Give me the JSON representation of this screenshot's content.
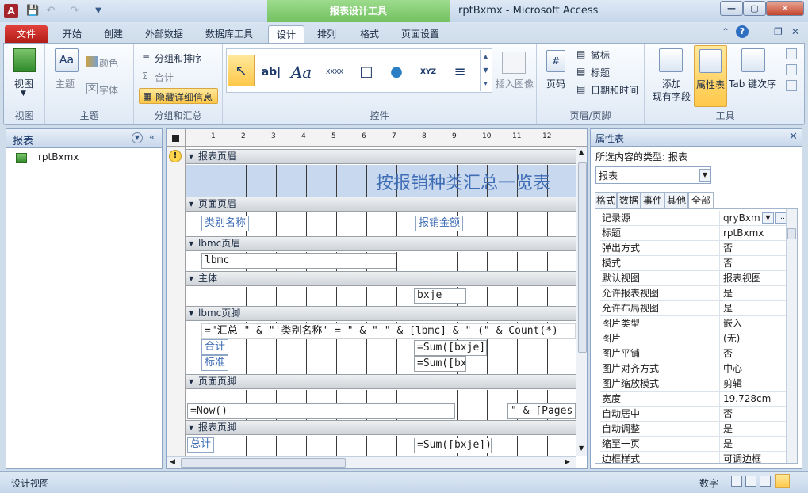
{
  "window": {
    "title": "rptBxmx  -  Microsoft Access",
    "context_tab_title": "报表设计工具",
    "app_icon_letter": "A"
  },
  "tabs": [
    "文件",
    "开始",
    "创建",
    "外部数据",
    "数据库工具",
    "设计",
    "排列",
    "格式",
    "页面设置"
  ],
  "ribbon": {
    "view": {
      "label": "视图",
      "group": "视图"
    },
    "theme": {
      "theme_label": "主题",
      "color_label": "颜色",
      "font_label": "字体",
      "group": "主题"
    },
    "grouping": {
      "sort_label": "分组和排序",
      "total_label": "合计",
      "hide_details_label": "隐藏详细信息",
      "group": "分组和汇总"
    },
    "controls": {
      "group": "控件",
      "label_glyph": "ab|",
      "aa_glyph": "Aa",
      "xxxx_glyph": "XXXX",
      "xyz_glyph": "XYZ"
    },
    "insert_image": {
      "label": "插入图像"
    },
    "header_footer": {
      "page_number_label": "页码",
      "logo_label": "徽标",
      "title_label": "标题",
      "datetime_label": "日期和时间",
      "group": "页眉/页脚"
    },
    "tools": {
      "add_fields_line1": "添加",
      "add_fields_line2": "现有字段",
      "property_sheet_label": "属性表",
      "tab_order_label": "Tab 键次序",
      "group": "工具"
    }
  },
  "nav": {
    "header": "报表",
    "items": [
      {
        "label": "rptBxmx"
      }
    ]
  },
  "design": {
    "ruler_labels": [
      "1",
      "2",
      "3",
      "4",
      "5",
      "6",
      "7",
      "8",
      "9",
      "10",
      "11",
      "12"
    ],
    "sections": {
      "report_header": "报表页眉",
      "page_header": "页面页眉",
      "lbmc_header": "lbmc页眉",
      "detail": "主体",
      "lbmc_footer": "lbmc页脚",
      "page_footer": "页面页脚",
      "report_footer": "报表页脚"
    },
    "title_text": "按报销种类汇总一览表",
    "page_header_labels": [
      "类别名称",
      "报销金额"
    ],
    "lbmc_field": "lbmc",
    "detail_field": "bxje",
    "footer_expr": "=\"汇总 \" & \"'类别名称' = \" & \" \" & [lbmc] & \" (\" & Count(*)",
    "subtotal_label": "合计",
    "subtotal_expr": "=Sum([bxje]",
    "std_label": "标准",
    "std_expr": "=Sum([bx",
    "now_expr": "=Now()",
    "pages_expr": "\" & [Pages",
    "grand_label": "总计",
    "grand_expr": "=Sum([bxje])"
  },
  "property_sheet": {
    "title": "属性表",
    "selection_type": "所选内容的类型: 报表",
    "object_select": "报表",
    "tabs": [
      "格式",
      "数据",
      "事件",
      "其他",
      "全部"
    ],
    "active_tab": "全部",
    "rows": [
      {
        "key": "记录源",
        "value": "qryBxmx"
      },
      {
        "key": "标题",
        "value": "rptBxmx"
      },
      {
        "key": "弹出方式",
        "value": "否"
      },
      {
        "key": "模式",
        "value": "否"
      },
      {
        "key": "默认视图",
        "value": "报表视图"
      },
      {
        "key": "允许报表视图",
        "value": "是"
      },
      {
        "key": "允许布局视图",
        "value": "是"
      },
      {
        "key": "图片类型",
        "value": "嵌入"
      },
      {
        "key": "图片",
        "value": "(无)"
      },
      {
        "key": "图片平铺",
        "value": "否"
      },
      {
        "key": "图片对齐方式",
        "value": "中心"
      },
      {
        "key": "图片缩放模式",
        "value": "剪辑"
      },
      {
        "key": "宽度",
        "value": "19.728cm"
      },
      {
        "key": "自动居中",
        "value": "否"
      },
      {
        "key": "自动调整",
        "value": "是"
      },
      {
        "key": "缩至一页",
        "value": "是"
      },
      {
        "key": "边框样式",
        "value": "可调边框"
      }
    ]
  },
  "status": {
    "left": "设计视图",
    "right": "数字"
  }
}
